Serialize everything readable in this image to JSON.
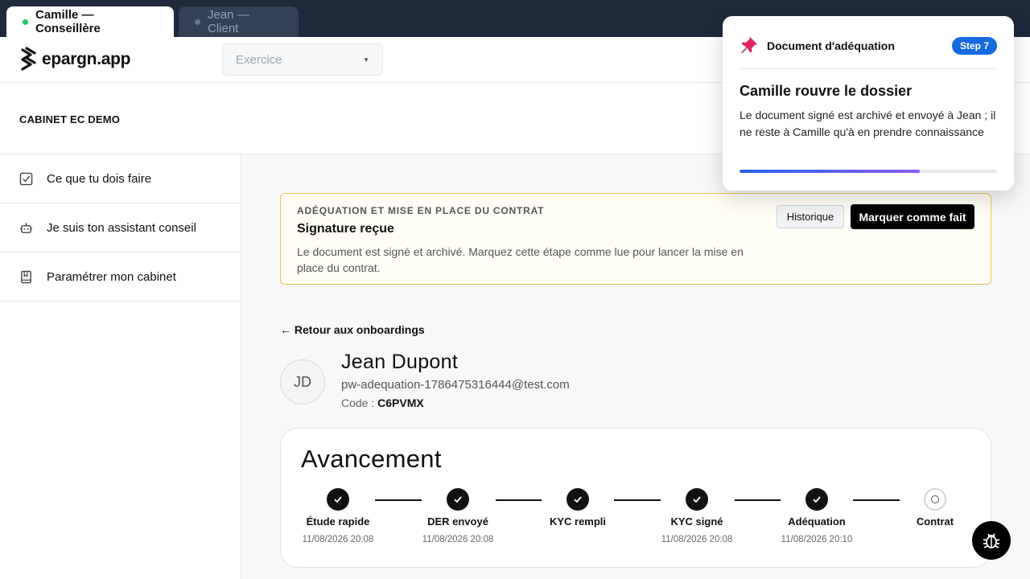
{
  "tabs": [
    {
      "label": "Camille — Conseillère",
      "dot_color": "#22c55e"
    },
    {
      "label": "Jean — Client",
      "dot_color": "#64748b"
    }
  ],
  "header": {
    "logo_text": "epargn.app",
    "select": {
      "value": "Exercice"
    }
  },
  "cabinet": {
    "name": "CABINET EC DEMO"
  },
  "sidebar": {
    "items": [
      {
        "label": "Ce que tu dois faire",
        "icon": "checkbox-icon"
      },
      {
        "label": "Je suis ton assistant conseil",
        "icon": "robot-icon"
      },
      {
        "label": "Paramétrer mon cabinet",
        "icon": "book-icon"
      }
    ]
  },
  "alert": {
    "eyebrow": "ADÉQUATION ET MISE EN PLACE DU CONTRAT",
    "title": "Signature reçue",
    "description": "Le document est signé et archivé. Marquez cette étape comme lue pour lancer la mise en place du contrat.",
    "history_label": "Historique",
    "done_label": "Marquer comme fait",
    "border_color": "#e5c453"
  },
  "back_link": "← Retour aux onboardings",
  "client": {
    "initials": "JD",
    "name": "Jean Dupont",
    "email": "pw-adequation-1786475316444@test.com",
    "code_label": "Code : ",
    "code": "C6PVMX"
  },
  "progress": {
    "title": "Avancement",
    "steps": [
      {
        "label": "Étude rapide",
        "date": "11/08/2026 20:08",
        "done": true
      },
      {
        "label": "DER envoyé",
        "date": "11/08/2026 20:08",
        "done": true
      },
      {
        "label": "KYC rempli",
        "date": "",
        "done": true
      },
      {
        "label": "KYC signé",
        "date": "11/08/2026 20:08",
        "done": true
      },
      {
        "label": "Adéquation",
        "date": "11/08/2026 20:10",
        "done": true
      },
      {
        "label": "Contrat",
        "date": "",
        "done": false
      }
    ]
  },
  "tutorial": {
    "header_title": "Document d'adéquation",
    "badge": "Step 7",
    "title": "Camille rouvre le dossier",
    "text": "Le document signé est archivé et envoyé à Jean ; il ne reste à Camille qu'à en prendre connaissance",
    "progress_fraction": 0.7,
    "badge_color": "#1769e0"
  },
  "bug_button_icon": "bug-icon"
}
